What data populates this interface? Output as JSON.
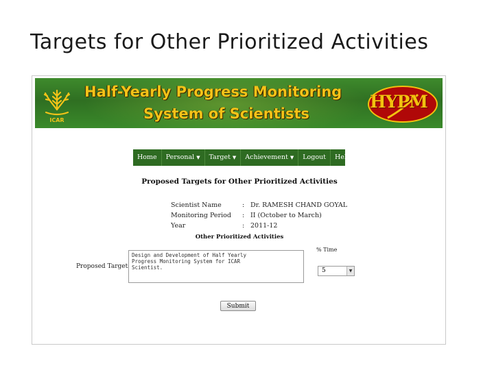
{
  "slide": {
    "title": "Targets for Other Prioritized Activities"
  },
  "banner": {
    "line1": "Half-Yearly Progress Monitoring",
    "line2": "System of Scientists",
    "logo_text": "HYPM",
    "org_logo_text": "ICAR",
    "colors": {
      "background": "#2f6f22",
      "title": "#f3c318"
    }
  },
  "nav": {
    "items": [
      {
        "label": "Home",
        "dropdown": false
      },
      {
        "label": "Personal",
        "dropdown": true
      },
      {
        "label": "Target",
        "dropdown": true
      },
      {
        "label": "Achievement",
        "dropdown": true
      },
      {
        "label": "Logout",
        "dropdown": false
      },
      {
        "label": "Help",
        "dropdown": true
      }
    ],
    "background": "#2e6b22"
  },
  "page": {
    "heading": "Proposed Targets for Other Prioritized Activities"
  },
  "info": [
    {
      "label": "Scientist Name",
      "sep": ":",
      "value": "Dr. RAMESH CHAND GOYAL"
    },
    {
      "label": "Monitoring Period",
      "sep": ":",
      "value": "II (October to March)"
    },
    {
      "label": "Year",
      "sep": ":",
      "value": "2011-12"
    }
  ],
  "form": {
    "section_heading": "Other Prioritized Activities",
    "targets_label": "Proposed Targets:",
    "targets_value": "Design and Development of Half Yearly\nProgress Monitoring System for ICAR\nScientist.",
    "time_label": "% Time",
    "time_value": "5",
    "submit_label": "Submit"
  }
}
